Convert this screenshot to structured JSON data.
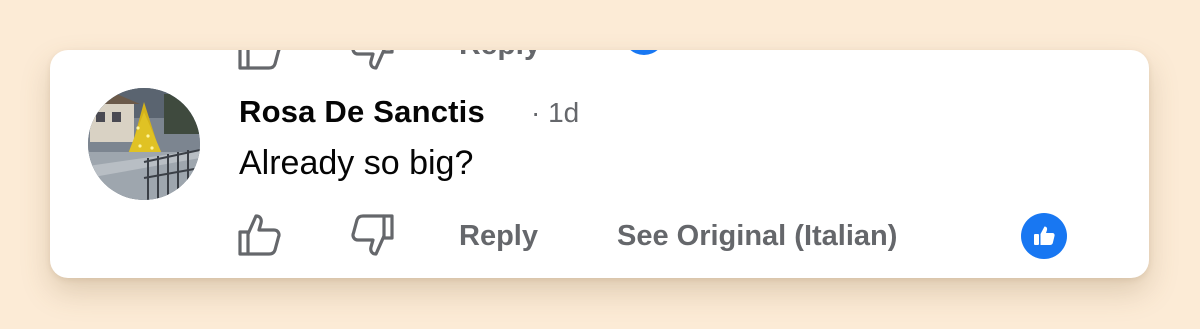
{
  "colors": {
    "page_background": "#fcebd6",
    "card_background": "#ffffff",
    "name_text": "#050505",
    "secondary_text": "#65676b",
    "reaction_blue": "#1877f2"
  },
  "previous_comment": {
    "reply_label": "Reply",
    "icons": [
      "like-icon",
      "dislike-icon",
      "reaction-badge-icon"
    ]
  },
  "comment": {
    "author": "Rosa De Sanctis",
    "separator": "·",
    "time": "1d",
    "text": "Already so big?",
    "avatar_icon": "avatar-christmas-tree-photo"
  },
  "actions": {
    "like_icon": "thumbs-up-outline-icon",
    "dislike_icon": "thumbs-down-outline-icon",
    "reply_label": "Reply",
    "see_original_label": "See Original (Italian)",
    "reaction_icon": "like-reaction-icon"
  }
}
